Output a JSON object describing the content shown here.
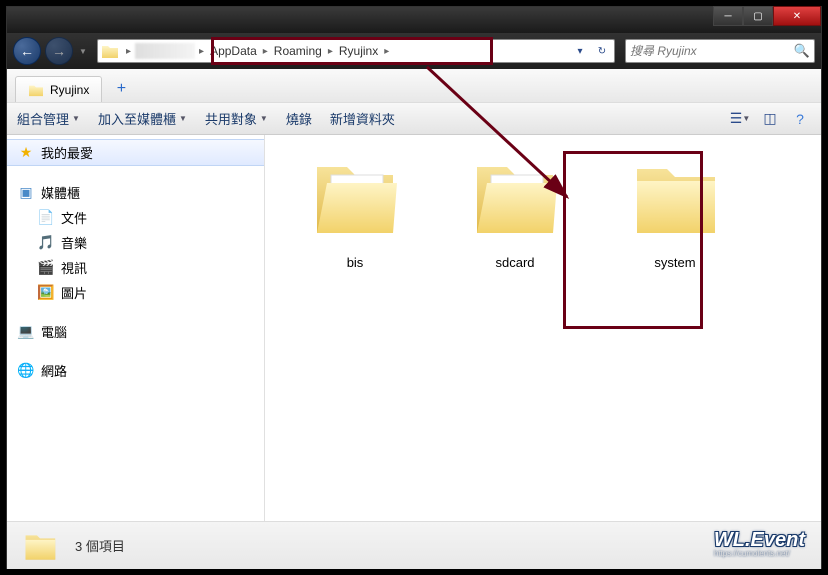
{
  "window": {
    "title": "Ryujinx"
  },
  "breadcrumb": {
    "seg1": "AppData",
    "seg2": "Roaming",
    "seg3": "Ryujinx"
  },
  "search": {
    "placeholder": "搜尋 Ryujinx"
  },
  "tab": {
    "label": "Ryujinx"
  },
  "toolbar": {
    "organize": "組合管理",
    "include": "加入至媒體櫃",
    "share": "共用對象",
    "burn": "燒錄",
    "newfolder": "新增資料夾"
  },
  "sidebar": {
    "favorites": "我的最愛",
    "libraries": "媒體櫃",
    "documents": "文件",
    "music": "音樂",
    "videos": "視訊",
    "pictures": "圖片",
    "computer": "電腦",
    "network": "網路"
  },
  "folders": [
    {
      "name": "bis",
      "has_content": true
    },
    {
      "name": "sdcard",
      "has_content": true
    },
    {
      "name": "system",
      "has_content": false
    }
  ],
  "status": {
    "text": "3 個項目"
  },
  "annotation": {
    "highlight_breadcrumb": true,
    "highlight_folder": "system",
    "arrow_color": "#6a0015"
  },
  "watermark": {
    "main": "WL.Event",
    "sub": "https://cumolents.net/"
  }
}
